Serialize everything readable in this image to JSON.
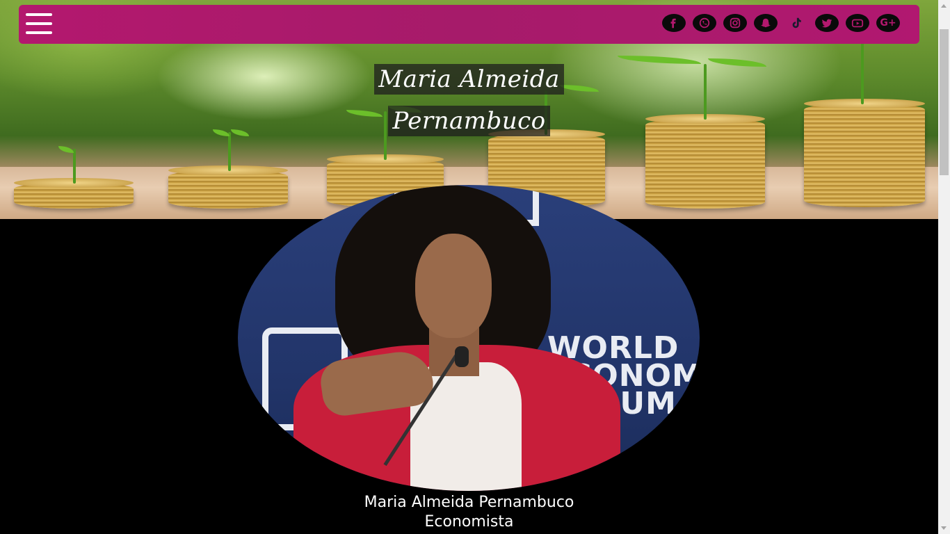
{
  "header": {
    "menu_icon": "hamburger-menu-icon",
    "social_links": [
      {
        "name": "facebook",
        "icon": "facebook-icon"
      },
      {
        "name": "whatsapp",
        "icon": "whatsapp-icon"
      },
      {
        "name": "instagram",
        "icon": "instagram-icon"
      },
      {
        "name": "snapchat",
        "icon": "snapchat-icon"
      },
      {
        "name": "tiktok",
        "icon": "tiktok-icon"
      },
      {
        "name": "twitter",
        "icon": "twitter-icon"
      },
      {
        "name": "youtube",
        "icon": "youtube-icon"
      },
      {
        "name": "google-plus",
        "icon": "google-plus-icon",
        "glyph": "G+"
      }
    ]
  },
  "hero": {
    "title_line1": "Maria Almeida",
    "title_line2": "Pernambuco"
  },
  "profile": {
    "name": "Maria Almeida Pernambuco",
    "role": "Economista",
    "backdrop_text": "WORLD\nECONOMIC\nFORUM"
  },
  "colors": {
    "navbar": "#b3186e",
    "background": "#000000",
    "caption_text": "#ffffff"
  }
}
